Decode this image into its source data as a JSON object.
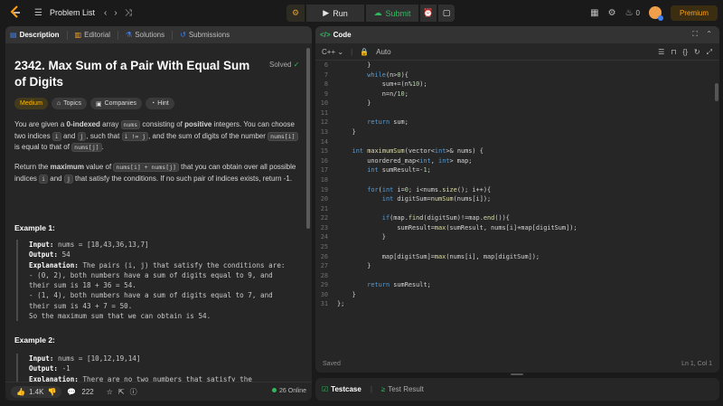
{
  "topbar": {
    "problem_list": "Problem List",
    "run": "Run",
    "submit": "Submit",
    "streak": "0",
    "premium": "Premium"
  },
  "left_tabs": {
    "description": "Description",
    "editorial": "Editorial",
    "solutions": "Solutions",
    "submissions": "Submissions"
  },
  "problem": {
    "title": "2342. Max Sum of a Pair With Equal Sum of Digits",
    "status": "Solved",
    "difficulty": "Medium",
    "tags": [
      "Topics",
      "Companies",
      "Hint"
    ],
    "para1_a": "You are given a ",
    "para1_b": "0-indexed",
    "para1_c": " array ",
    "para1_d": "nums",
    "para1_e": " consisting of ",
    "para1_f": "positive",
    "para1_g": " integers. You can choose two indices ",
    "para1_h": "i",
    "para1_i": " and ",
    "para1_j": "j",
    "para1_k": ", such that ",
    "para1_l": "i != j",
    "para1_m": ", and the sum of digits of the number ",
    "para1_n": "nums[i]",
    "para1_o": " is equal to that of ",
    "para1_p": "nums[j]",
    "para1_q": ".",
    "para2_a": "Return the ",
    "para2_b": "maximum",
    "para2_c": " value of ",
    "para2_d": "nums[i] + nums[j]",
    "para2_e": " that you can obtain over all possible indices ",
    "para2_f": "i",
    "para2_g": " and ",
    "para2_h": "j",
    "para2_i": " that satisfy the conditions. If no such pair of indices exists, return -1.",
    "example1_title": "Example 1:",
    "ex1_input_label": "Input:",
    "ex1_input": " nums = [18,43,36,13,7]",
    "ex1_output_label": "Output:",
    "ex1_output": " 54",
    "ex1_expl_label": "Explanation:",
    "ex1_expl_1": " The pairs (i, j) that satisfy the conditions are:",
    "ex1_expl_2": "- (0, 2), both numbers have a sum of digits equal to 9, and",
    "ex1_expl_3": "their sum is 18 + 36 = 54.",
    "ex1_expl_4": "- (1, 4), both numbers have a sum of digits equal to 7, and",
    "ex1_expl_5": "their sum is 43 + 7 = 50.",
    "ex1_expl_6": "So the maximum sum that we can obtain is 54.",
    "example2_title": "Example 2:",
    "ex2_input_label": "Input:",
    "ex2_input": " nums = [10,12,19,14]",
    "ex2_output_label": "Output:",
    "ex2_output": " -1",
    "ex2_expl_label": "Explanation:",
    "ex2_expl_1": " There are no two numbers that satisfy the"
  },
  "left_footer": {
    "likes": "1.4K",
    "comments": "222",
    "online": "26 Online"
  },
  "code_panel": {
    "title": "Code",
    "language": "C++",
    "mode": "Auto",
    "status": "Saved",
    "cursor": "Ln 1, Col 1"
  },
  "code_lines": [
    {
      "n": "6",
      "t": "        }"
    },
    {
      "n": "7",
      "t": "        while(n>0){"
    },
    {
      "n": "8",
      "t": "            sum+=(n%10);"
    },
    {
      "n": "9",
      "t": "            n=n/10;"
    },
    {
      "n": "10",
      "t": "        }"
    },
    {
      "n": "11",
      "t": ""
    },
    {
      "n": "12",
      "t": "        return sum;"
    },
    {
      "n": "13",
      "t": "    }"
    },
    {
      "n": "14",
      "t": ""
    },
    {
      "n": "15",
      "t": "    int maximumSum(vector<int>& nums) {"
    },
    {
      "n": "16",
      "t": "        unordered_map<int, int> map;"
    },
    {
      "n": "17",
      "t": "        int sumResult=-1;"
    },
    {
      "n": "18",
      "t": ""
    },
    {
      "n": "19",
      "t": "        for(int i=0; i<nums.size(); i++){"
    },
    {
      "n": "20",
      "t": "            int digitSum=numSum(nums[i]);"
    },
    {
      "n": "21",
      "t": ""
    },
    {
      "n": "22",
      "t": "            if(map.find(digitSum)!=map.end()){"
    },
    {
      "n": "23",
      "t": "                sumResult=max(sumResult, nums[i]+map[digitSum]);"
    },
    {
      "n": "24",
      "t": "            }"
    },
    {
      "n": "25",
      "t": ""
    },
    {
      "n": "26",
      "t": "            map[digitSum]=max(nums[i], map[digitSum]);"
    },
    {
      "n": "27",
      "t": "        }"
    },
    {
      "n": "28",
      "t": ""
    },
    {
      "n": "29",
      "t": "        return sumResult;"
    },
    {
      "n": "30",
      "t": "    }"
    },
    {
      "n": "31",
      "t": "};"
    }
  ],
  "test_panel": {
    "testcase": "Testcase",
    "test_result": "Test Result"
  },
  "colors": {
    "accent_green": "#2cbb5d",
    "premium": "#ffa116",
    "medium": "#ffb800"
  }
}
